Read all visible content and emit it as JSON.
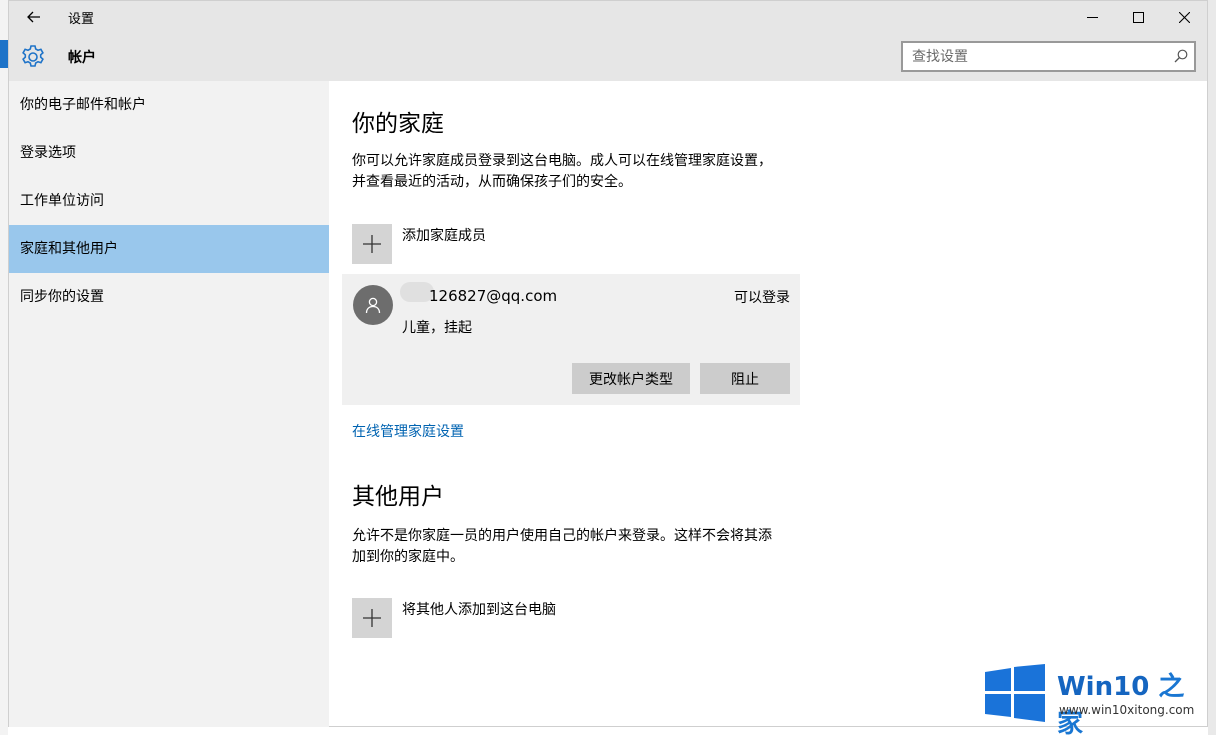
{
  "window": {
    "title": "设置",
    "controls": {
      "minimize": "—",
      "maximize": "☐",
      "close": "✕"
    }
  },
  "header": {
    "title": "帐户",
    "search_placeholder": "查找设置"
  },
  "sidebar": {
    "items": [
      {
        "label": "你的电子邮件和帐户",
        "active": false
      },
      {
        "label": "登录选项",
        "active": false
      },
      {
        "label": "工作单位访问",
        "active": false
      },
      {
        "label": "家庭和其他用户",
        "active": true
      },
      {
        "label": "同步你的设置",
        "active": false
      }
    ]
  },
  "family": {
    "heading": "你的家庭",
    "description": "你可以允许家庭成员登录到这台电脑。成人可以在线管理家庭设置，并查看最近的活动，从而确保孩子们的安全。",
    "add_label": "添加家庭成员",
    "member": {
      "email": "126827@qq.com",
      "status": "可以登录",
      "role": "儿童，挂起",
      "change_type_label": "更改帐户类型",
      "block_label": "阻止"
    },
    "manage_link": "在线管理家庭设置"
  },
  "others": {
    "heading": "其他用户",
    "description": "允许不是你家庭一员的用户使用自己的帐户来登录。这样不会将其添加到你的家庭中。",
    "add_label": "将其他人添加到这台电脑"
  },
  "watermark": {
    "brand_main": "Win10",
    "brand_suffix": "之家",
    "url": "www.win10xitong.com"
  },
  "colors": {
    "accent": "#0063b1",
    "active_nav": "#99c7ec",
    "sidebar_bg": "#f2f2f2"
  }
}
